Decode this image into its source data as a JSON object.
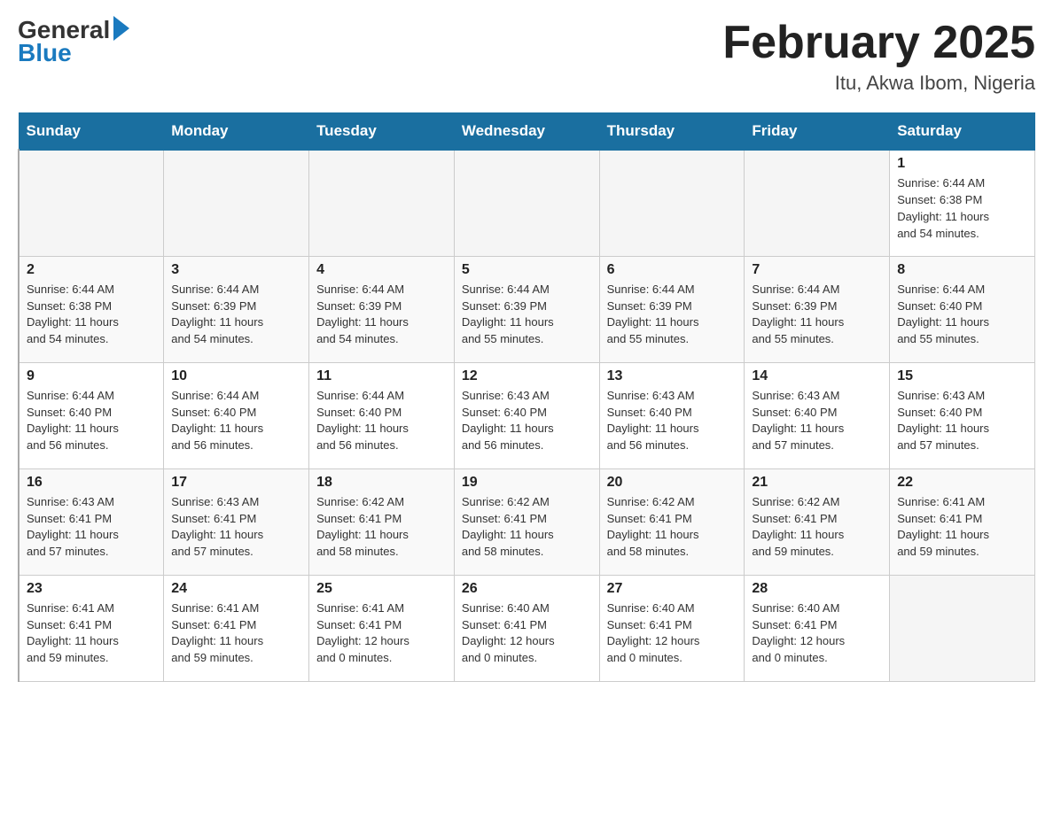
{
  "header": {
    "logo_general": "General",
    "logo_blue": "Blue",
    "title": "February 2025",
    "subtitle": "Itu, Akwa Ibom, Nigeria"
  },
  "weekdays": [
    "Sunday",
    "Monday",
    "Tuesday",
    "Wednesday",
    "Thursday",
    "Friday",
    "Saturday"
  ],
  "weeks": [
    [
      {
        "day": "",
        "info": ""
      },
      {
        "day": "",
        "info": ""
      },
      {
        "day": "",
        "info": ""
      },
      {
        "day": "",
        "info": ""
      },
      {
        "day": "",
        "info": ""
      },
      {
        "day": "",
        "info": ""
      },
      {
        "day": "1",
        "info": "Sunrise: 6:44 AM\nSunset: 6:38 PM\nDaylight: 11 hours\nand 54 minutes."
      }
    ],
    [
      {
        "day": "2",
        "info": "Sunrise: 6:44 AM\nSunset: 6:38 PM\nDaylight: 11 hours\nand 54 minutes."
      },
      {
        "day": "3",
        "info": "Sunrise: 6:44 AM\nSunset: 6:39 PM\nDaylight: 11 hours\nand 54 minutes."
      },
      {
        "day": "4",
        "info": "Sunrise: 6:44 AM\nSunset: 6:39 PM\nDaylight: 11 hours\nand 54 minutes."
      },
      {
        "day": "5",
        "info": "Sunrise: 6:44 AM\nSunset: 6:39 PM\nDaylight: 11 hours\nand 55 minutes."
      },
      {
        "day": "6",
        "info": "Sunrise: 6:44 AM\nSunset: 6:39 PM\nDaylight: 11 hours\nand 55 minutes."
      },
      {
        "day": "7",
        "info": "Sunrise: 6:44 AM\nSunset: 6:39 PM\nDaylight: 11 hours\nand 55 minutes."
      },
      {
        "day": "8",
        "info": "Sunrise: 6:44 AM\nSunset: 6:40 PM\nDaylight: 11 hours\nand 55 minutes."
      }
    ],
    [
      {
        "day": "9",
        "info": "Sunrise: 6:44 AM\nSunset: 6:40 PM\nDaylight: 11 hours\nand 56 minutes."
      },
      {
        "day": "10",
        "info": "Sunrise: 6:44 AM\nSunset: 6:40 PM\nDaylight: 11 hours\nand 56 minutes."
      },
      {
        "day": "11",
        "info": "Sunrise: 6:44 AM\nSunset: 6:40 PM\nDaylight: 11 hours\nand 56 minutes."
      },
      {
        "day": "12",
        "info": "Sunrise: 6:43 AM\nSunset: 6:40 PM\nDaylight: 11 hours\nand 56 minutes."
      },
      {
        "day": "13",
        "info": "Sunrise: 6:43 AM\nSunset: 6:40 PM\nDaylight: 11 hours\nand 56 minutes."
      },
      {
        "day": "14",
        "info": "Sunrise: 6:43 AM\nSunset: 6:40 PM\nDaylight: 11 hours\nand 57 minutes."
      },
      {
        "day": "15",
        "info": "Sunrise: 6:43 AM\nSunset: 6:40 PM\nDaylight: 11 hours\nand 57 minutes."
      }
    ],
    [
      {
        "day": "16",
        "info": "Sunrise: 6:43 AM\nSunset: 6:41 PM\nDaylight: 11 hours\nand 57 minutes."
      },
      {
        "day": "17",
        "info": "Sunrise: 6:43 AM\nSunset: 6:41 PM\nDaylight: 11 hours\nand 57 minutes."
      },
      {
        "day": "18",
        "info": "Sunrise: 6:42 AM\nSunset: 6:41 PM\nDaylight: 11 hours\nand 58 minutes."
      },
      {
        "day": "19",
        "info": "Sunrise: 6:42 AM\nSunset: 6:41 PM\nDaylight: 11 hours\nand 58 minutes."
      },
      {
        "day": "20",
        "info": "Sunrise: 6:42 AM\nSunset: 6:41 PM\nDaylight: 11 hours\nand 58 minutes."
      },
      {
        "day": "21",
        "info": "Sunrise: 6:42 AM\nSunset: 6:41 PM\nDaylight: 11 hours\nand 59 minutes."
      },
      {
        "day": "22",
        "info": "Sunrise: 6:41 AM\nSunset: 6:41 PM\nDaylight: 11 hours\nand 59 minutes."
      }
    ],
    [
      {
        "day": "23",
        "info": "Sunrise: 6:41 AM\nSunset: 6:41 PM\nDaylight: 11 hours\nand 59 minutes."
      },
      {
        "day": "24",
        "info": "Sunrise: 6:41 AM\nSunset: 6:41 PM\nDaylight: 11 hours\nand 59 minutes."
      },
      {
        "day": "25",
        "info": "Sunrise: 6:41 AM\nSunset: 6:41 PM\nDaylight: 12 hours\nand 0 minutes."
      },
      {
        "day": "26",
        "info": "Sunrise: 6:40 AM\nSunset: 6:41 PM\nDaylight: 12 hours\nand 0 minutes."
      },
      {
        "day": "27",
        "info": "Sunrise: 6:40 AM\nSunset: 6:41 PM\nDaylight: 12 hours\nand 0 minutes."
      },
      {
        "day": "28",
        "info": "Sunrise: 6:40 AM\nSunset: 6:41 PM\nDaylight: 12 hours\nand 0 minutes."
      },
      {
        "day": "",
        "info": ""
      }
    ]
  ]
}
